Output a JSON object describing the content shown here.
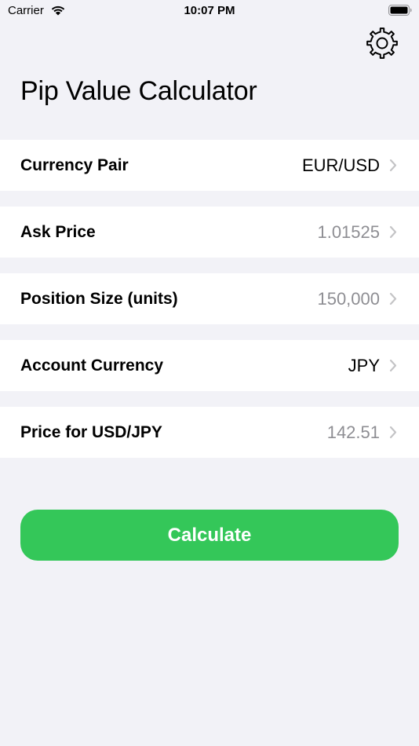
{
  "status_bar": {
    "carrier": "Carrier",
    "time": "10:07 PM"
  },
  "header": {
    "title": "Pip Value Calculator",
    "settings_icon": "gear-icon"
  },
  "rows": [
    {
      "label": "Currency Pair",
      "value": "EUR/USD",
      "style": "selected"
    },
    {
      "label": "Ask Price",
      "value": "1.01525",
      "style": "muted"
    },
    {
      "label": "Position Size (units)",
      "value": "150,000",
      "style": "muted"
    },
    {
      "label": "Account Currency",
      "value": "JPY",
      "style": "selected"
    },
    {
      "label": "Price for USD/JPY",
      "value": "142.51",
      "style": "muted"
    }
  ],
  "calculate_button": {
    "label": "Calculate"
  },
  "colors": {
    "background": "#f2f2f7",
    "row_background": "#ffffff",
    "accent_green": "#34c759",
    "muted_text": "#8e8e93",
    "chevron": "#c4c4c6"
  }
}
